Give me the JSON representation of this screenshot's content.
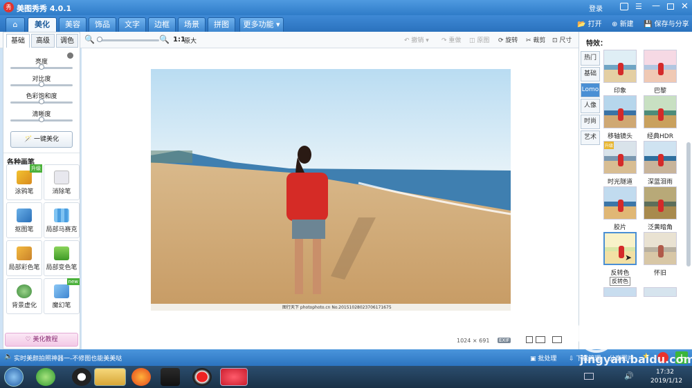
{
  "window": {
    "title": "美图秀秀 4.0.1",
    "login": "登录"
  },
  "menu": {
    "tabs": [
      "美化",
      "美容",
      "饰品",
      "文字",
      "边框",
      "场景",
      "拼图",
      "更多功能"
    ],
    "open": "打开",
    "new": "新建",
    "save": "保存与分享"
  },
  "toolbar": {
    "zoom_ratio": "1:1",
    "zoom_label": "原大",
    "undo": "撤销",
    "redo": "重做",
    "original": "原图",
    "rotate": "旋转",
    "crop": "裁剪",
    "size": "尺寸"
  },
  "left": {
    "subtabs": [
      "基础",
      "高级",
      "调色"
    ],
    "adjust": [
      {
        "label": "亮度",
        "value": 0.5
      },
      {
        "label": "对比度",
        "value": 0.5
      },
      {
        "label": "色彩饱和度",
        "value": 0.5
      },
      {
        "label": "清晰度",
        "value": 0.5
      }
    ],
    "one_click": "一键美化",
    "pens_title": "各种画笔",
    "pens": [
      "涂鸦笔",
      "消除笔",
      "抠图笔",
      "局部马赛克",
      "局部彩色笔",
      "局部变色笔",
      "背景虚化",
      "魔幻笔"
    ],
    "badge_upgrade": "升级",
    "badge_new": "new",
    "tutorial": "美化教程"
  },
  "canvas": {
    "watermark": "图行天下 photophoto.cn  No.20151028023706171675",
    "dimensions": "1024 × 691",
    "exif": "EXIF"
  },
  "right": {
    "title": "特效：",
    "cats": [
      "热门",
      "基础",
      "Lomo",
      "人像",
      "时尚",
      "艺术"
    ],
    "effects": [
      "印象",
      "巴黎",
      "移轴镜头",
      "经典HDR",
      "时光隧道",
      "深蓝泪雨",
      "胶片",
      "泛黄暗角",
      "反转色",
      "怀旧"
    ],
    "tooltip": "反转色",
    "badge": "升级"
  },
  "status": {
    "tip": "实时美颜拍照神器一-不修图也能美美哒",
    "batch": "批处理",
    "download": "下载管理",
    "share": "分享图片"
  },
  "taskbar": {
    "time": "17:32",
    "date": "2019/1/12"
  },
  "watermark": {
    "site": "jingyan.baidu.com",
    "brand": "Bai度经验"
  }
}
